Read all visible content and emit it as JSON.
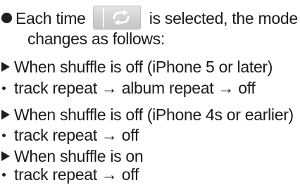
{
  "intro": {
    "before_icon": "Each time",
    "icon_name": "repeat-icon",
    "after_icon": "is selected, the mode",
    "continuation": "changes as follows:"
  },
  "sections": [
    {
      "heading": "When shuffle is off (iPhone 5 or later)",
      "detail": "track repeat → album repeat → off"
    },
    {
      "heading": "When shuffle is off (iPhone 4s or earlier)",
      "detail": "track repeat → off"
    },
    {
      "heading": "When shuffle is on",
      "detail": "track repeat → off"
    }
  ],
  "colors": {
    "text": "#1a1a1a",
    "button_bg": "#d2d2d2",
    "icon": "#ffffff"
  }
}
